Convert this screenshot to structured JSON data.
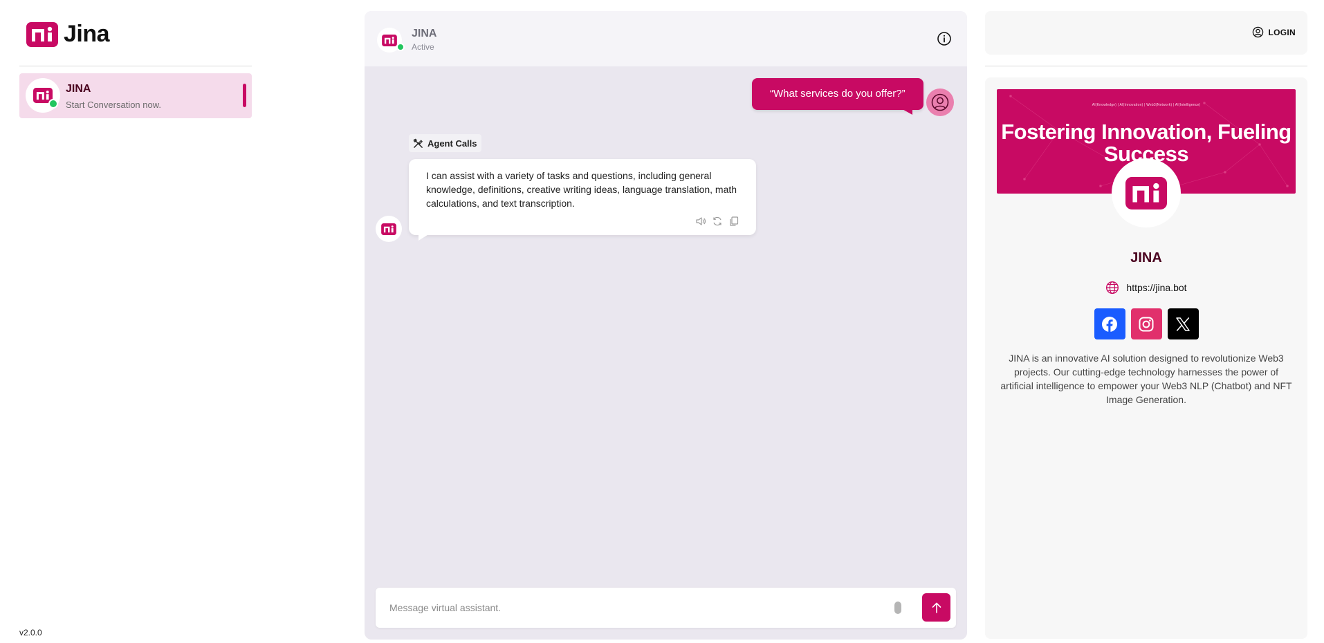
{
  "brand": {
    "name": "Jina",
    "accent_color": "#c80a63",
    "logo_icon": "jina-logo-icon"
  },
  "sidebar": {
    "conversations": [
      {
        "name": "JINA",
        "subtitle": "Start Conversation now.",
        "status": "online"
      }
    ],
    "version": "v2.0.0"
  },
  "chat": {
    "header": {
      "name": "JINA",
      "status": "Active"
    },
    "messages": [
      {
        "role": "user",
        "text": "“What services do you offer?”"
      },
      {
        "role": "assistant",
        "agent_calls_label": "Agent Calls",
        "text": "I can assist with a variety of tasks and questions, including general knowledge, definitions, creative writing ideas, language translation, math calculations, and text transcription.",
        "actions": [
          "speaker-icon",
          "regenerate-icon",
          "copy-icon"
        ]
      }
    ],
    "composer": {
      "placeholder": "Message virtual assistant."
    }
  },
  "right_panel": {
    "login_label": "LOGIN",
    "profile": {
      "banner_tagline": "AI(Knowledge) | AI(Innovation) | Web3(Network) | AI(Intelligence)",
      "banner_title": "Fostering Innovation, Fueling Success",
      "name": "JINA",
      "website": "https://jina.bot",
      "socials": [
        "facebook-icon",
        "instagram-icon",
        "x-icon"
      ],
      "description": "JINA is an innovative AI solution designed to revolutionize Web3 projects. Our cutting-edge technology harnesses the power of artificial intelligence to empower your Web3 NLP (Chatbot) and NFT Image Generation."
    }
  }
}
